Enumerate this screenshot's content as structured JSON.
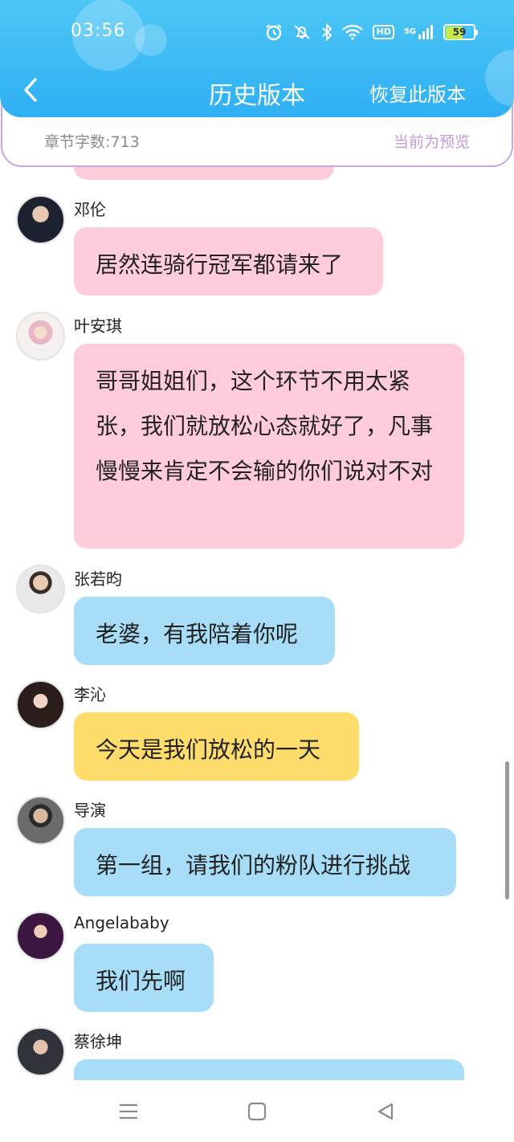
{
  "status_bar": {
    "time": "03:56",
    "battery_level": "59",
    "hd_label": "HD",
    "network_label": "5G",
    "icons": [
      "alarm-icon",
      "mute-icon",
      "bluetooth-icon",
      "wifi-icon",
      "hd-icon",
      "signal-icon",
      "battery-icon"
    ]
  },
  "header": {
    "title": "历史版本",
    "back_icon": "chevron-left-icon",
    "restore_label": "恢复此版本"
  },
  "info": {
    "word_count": "章节字数:713",
    "preview_label": "当前为预览"
  },
  "messages": [
    {
      "sender": "",
      "text": "",
      "color": "pink"
    },
    {
      "sender": "邓伦",
      "text": "居然连骑行冠军都请来了",
      "color": "pink"
    },
    {
      "sender": "叶安琪",
      "text": "哥哥姐姐们，这个环节不用太紧张，我们就放松心态就好了，凡事慢慢来肯定不会输的你们说对不对",
      "color": "pink"
    },
    {
      "sender": "张若昀",
      "text": "老婆，有我陪着你呢",
      "color": "blue"
    },
    {
      "sender": "李沁",
      "text": "今天是我们放松的一天",
      "color": "yellow"
    },
    {
      "sender": "导演",
      "text": "第一组，请我们的粉队进行挑战",
      "color": "blue"
    },
    {
      "sender": "Angelababy",
      "text": "我们先啊",
      "color": "blue"
    },
    {
      "sender": "蔡徐坤",
      "text": "",
      "color": "blue"
    }
  ],
  "colors": {
    "header": "#2fb0f3",
    "bubble_pink": "#ffcdd9",
    "bubble_blue": "#a8ddf8",
    "bubble_yellow": "#fddc6c",
    "strip_border": "#c7a7e6",
    "preview_text": "#c39ad8"
  },
  "system_nav": {
    "icons": [
      "menu-icon",
      "home-icon",
      "back-triangle-icon"
    ]
  }
}
